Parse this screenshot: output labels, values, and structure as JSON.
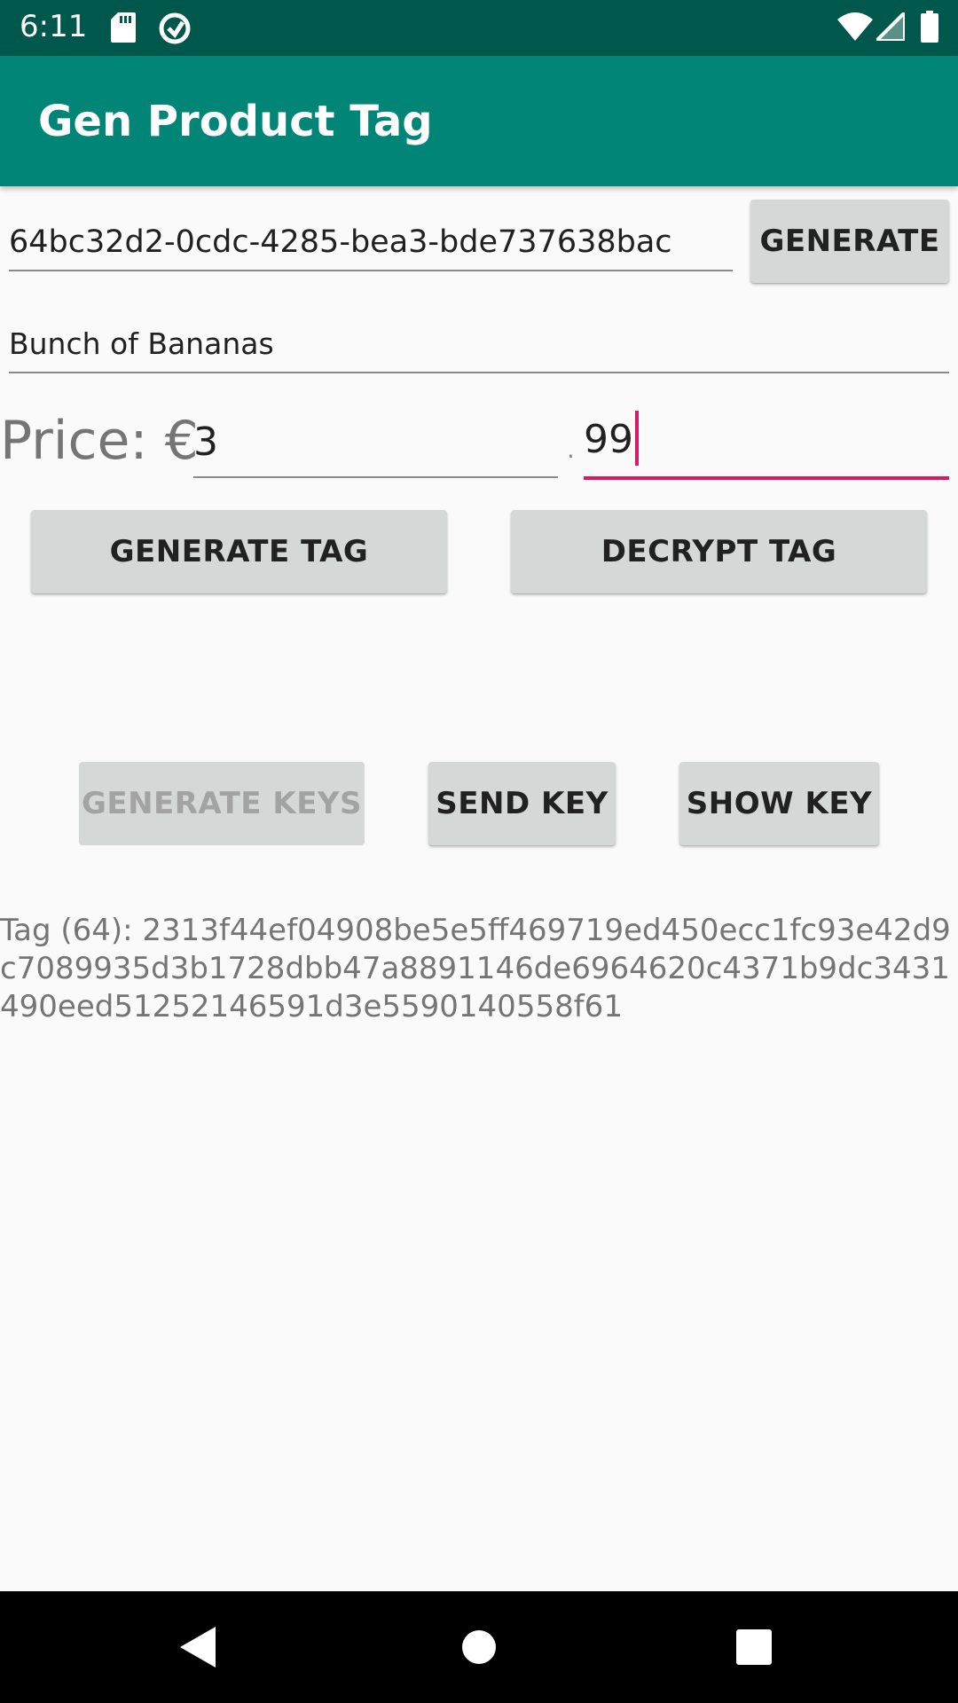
{
  "status_bar": {
    "time": "6:11",
    "icons": [
      "sd-card-icon",
      "sync-icon",
      "wifi-icon",
      "signal-icon",
      "battery-icon"
    ]
  },
  "app_bar": {
    "title": "Gen Product Tag"
  },
  "form": {
    "product_id": "64bc32d2-0cdc-4285-bea3-bde737638bac",
    "generate_label": "GENERATE",
    "product_name": "Bunch of Bananas",
    "price_label": "Price: €",
    "price_whole": "3",
    "decimal_separator": ".",
    "price_cents": "99",
    "generate_tag_label": "GENERATE TAG",
    "decrypt_tag_label": "DECRYPT TAG",
    "generate_keys_label": "GENERATE KEYS",
    "send_key_label": "SEND KEY",
    "show_key_label": "SHOW KEY"
  },
  "output": {
    "tag_text": "Tag (64): 2313f44ef04908be5e5ff469719ed450ecc1fc93e42d9c7089935d3b1728dbb47a8891146de6964620c4371b9dc3431490eed51252146591d3e5590140558f61"
  },
  "colors": {
    "status_bar": "#00574b",
    "app_bar": "#008577",
    "accent": "#d81b60",
    "button": "#d6d7d7"
  },
  "nav_bar": {
    "icons": [
      "back-icon",
      "home-icon",
      "recents-icon"
    ]
  }
}
